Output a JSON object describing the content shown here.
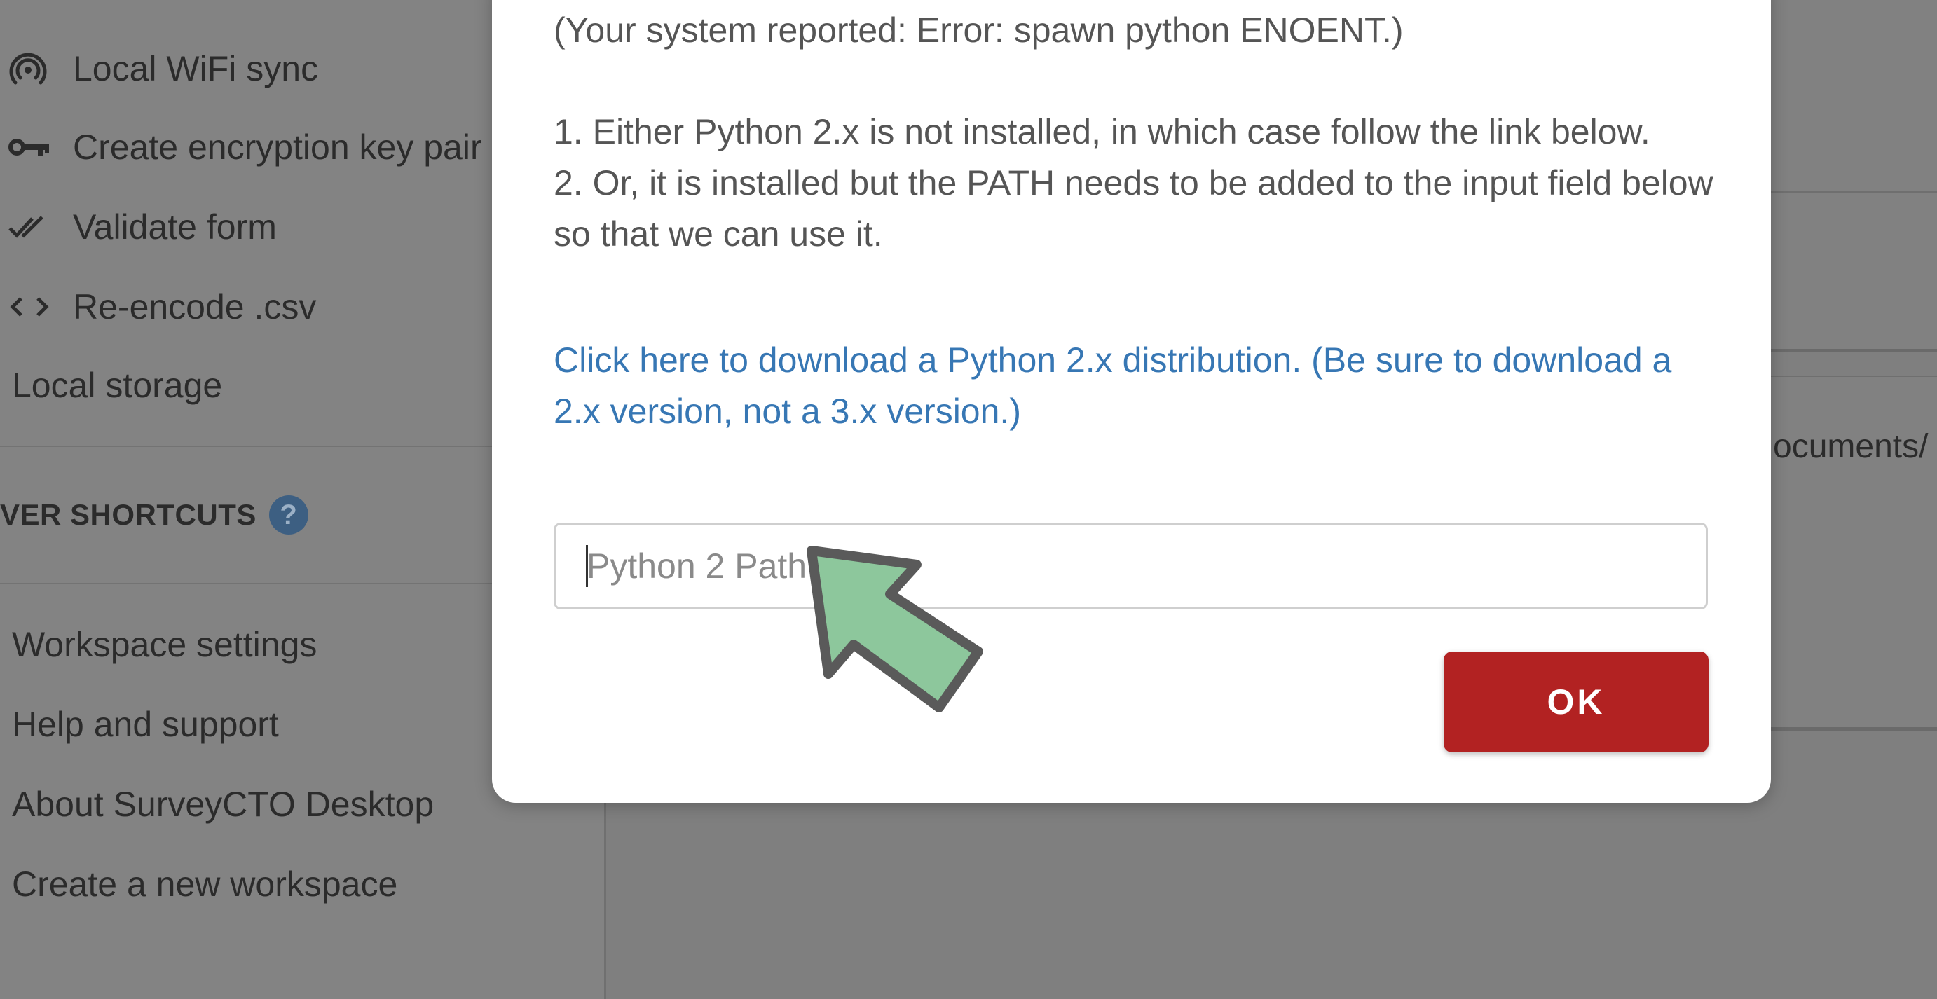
{
  "sidebar": {
    "items": [
      {
        "icon": "wifi-sync-icon",
        "label": "Local WiFi sync"
      },
      {
        "icon": "key-icon",
        "label": "Create encryption key pair"
      },
      {
        "icon": "double-check-icon",
        "label": "Validate form"
      },
      {
        "icon": "code-icon",
        "label": "Re-encode .csv"
      }
    ],
    "local_storage": "Local storage",
    "section_title": "VER SHORTCUTS",
    "help_badge": "?",
    "bottom_items": [
      "Workspace settings",
      "Help and support",
      "About SurveyCTO Desktop",
      "Create a new workspace"
    ]
  },
  "background": {
    "right_text": "ocuments/"
  },
  "dialog": {
    "system_reported": "(Your system reported: Error: spawn python ENOENT.)",
    "option_1": "1. Either Python 2.x is not installed, in which case follow the link below.",
    "option_2": "2. Or, it is installed but the PATH needs to be added to the input field below so that we can use it.",
    "download_link": "Click here to download a Python 2.x distribution. (Be sure to download a 2.x version, not a 3.x version.)",
    "path_input": {
      "placeholder": "Python 2 Path",
      "value": ""
    },
    "ok_label": "OK"
  },
  "colors": {
    "overlay": "#7f7f7f",
    "link": "#3777b4",
    "ok_button": "#b22222",
    "arrow_fill": "#8dc79c",
    "arrow_stroke": "#5a5a5a"
  }
}
